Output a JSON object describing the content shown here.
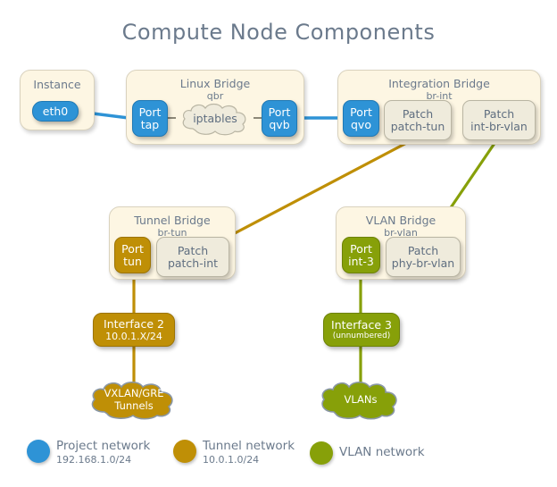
{
  "title": "Compute Node Components",
  "colors": {
    "project_network": "#2e93d6",
    "tunnel_network": "#bf8f06",
    "vlan_network": "#87a009",
    "box_fill": "#fdf6e3",
    "patch_fill": "#efebdc",
    "text_muted": "#6b7a8c"
  },
  "boxes": {
    "instance": {
      "title": "Instance",
      "port": {
        "label": "eth0"
      }
    },
    "linux_bridge": {
      "title": "Linux Bridge",
      "subtitle": "qbr",
      "port_left": {
        "line1": "Port",
        "line2": "tap"
      },
      "cloud": {
        "label": "iptables"
      },
      "port_right": {
        "line1": "Port",
        "line2": "qvb"
      }
    },
    "integration_bridge": {
      "title": "Integration Bridge",
      "subtitle": "br-int",
      "port": {
        "line1": "Port",
        "line2": "qvo"
      },
      "patch_tun": {
        "line1": "Patch",
        "line2": "patch-tun"
      },
      "patch_vlan": {
        "line1": "Patch",
        "line2": "int-br-vlan"
      }
    },
    "tunnel_bridge": {
      "title": "Tunnel Bridge",
      "subtitle": "br-tun",
      "port": {
        "line1": "Port",
        "line2": "tun"
      },
      "patch": {
        "line1": "Patch",
        "line2": "patch-int"
      }
    },
    "vlan_bridge": {
      "title": "VLAN Bridge",
      "subtitle": "br-vlan",
      "port": {
        "line1": "Port",
        "line2": "int-3"
      },
      "patch": {
        "line1": "Patch",
        "line2": "phy-br-vlan"
      }
    }
  },
  "interfaces": {
    "interface2": {
      "name": "Interface 2",
      "sub": "10.0.1.X/24"
    },
    "interface3": {
      "name": "Interface 3",
      "sub": "(unnumbered)"
    }
  },
  "clouds": {
    "tunnels": {
      "line1": "VXLAN/GRE",
      "line2": "Tunnels"
    },
    "vlans": {
      "line1": "VLANs",
      "line2": ""
    }
  },
  "legend": {
    "items": [
      {
        "name": "Project network",
        "sub": "192.168.1.0/24",
        "color": "#2e93d6"
      },
      {
        "name": "Tunnel network",
        "sub": "10.0.1.0/24",
        "color": "#bf8f06"
      },
      {
        "name": "VLAN network",
        "sub": "",
        "color": "#87a009"
      }
    ]
  }
}
